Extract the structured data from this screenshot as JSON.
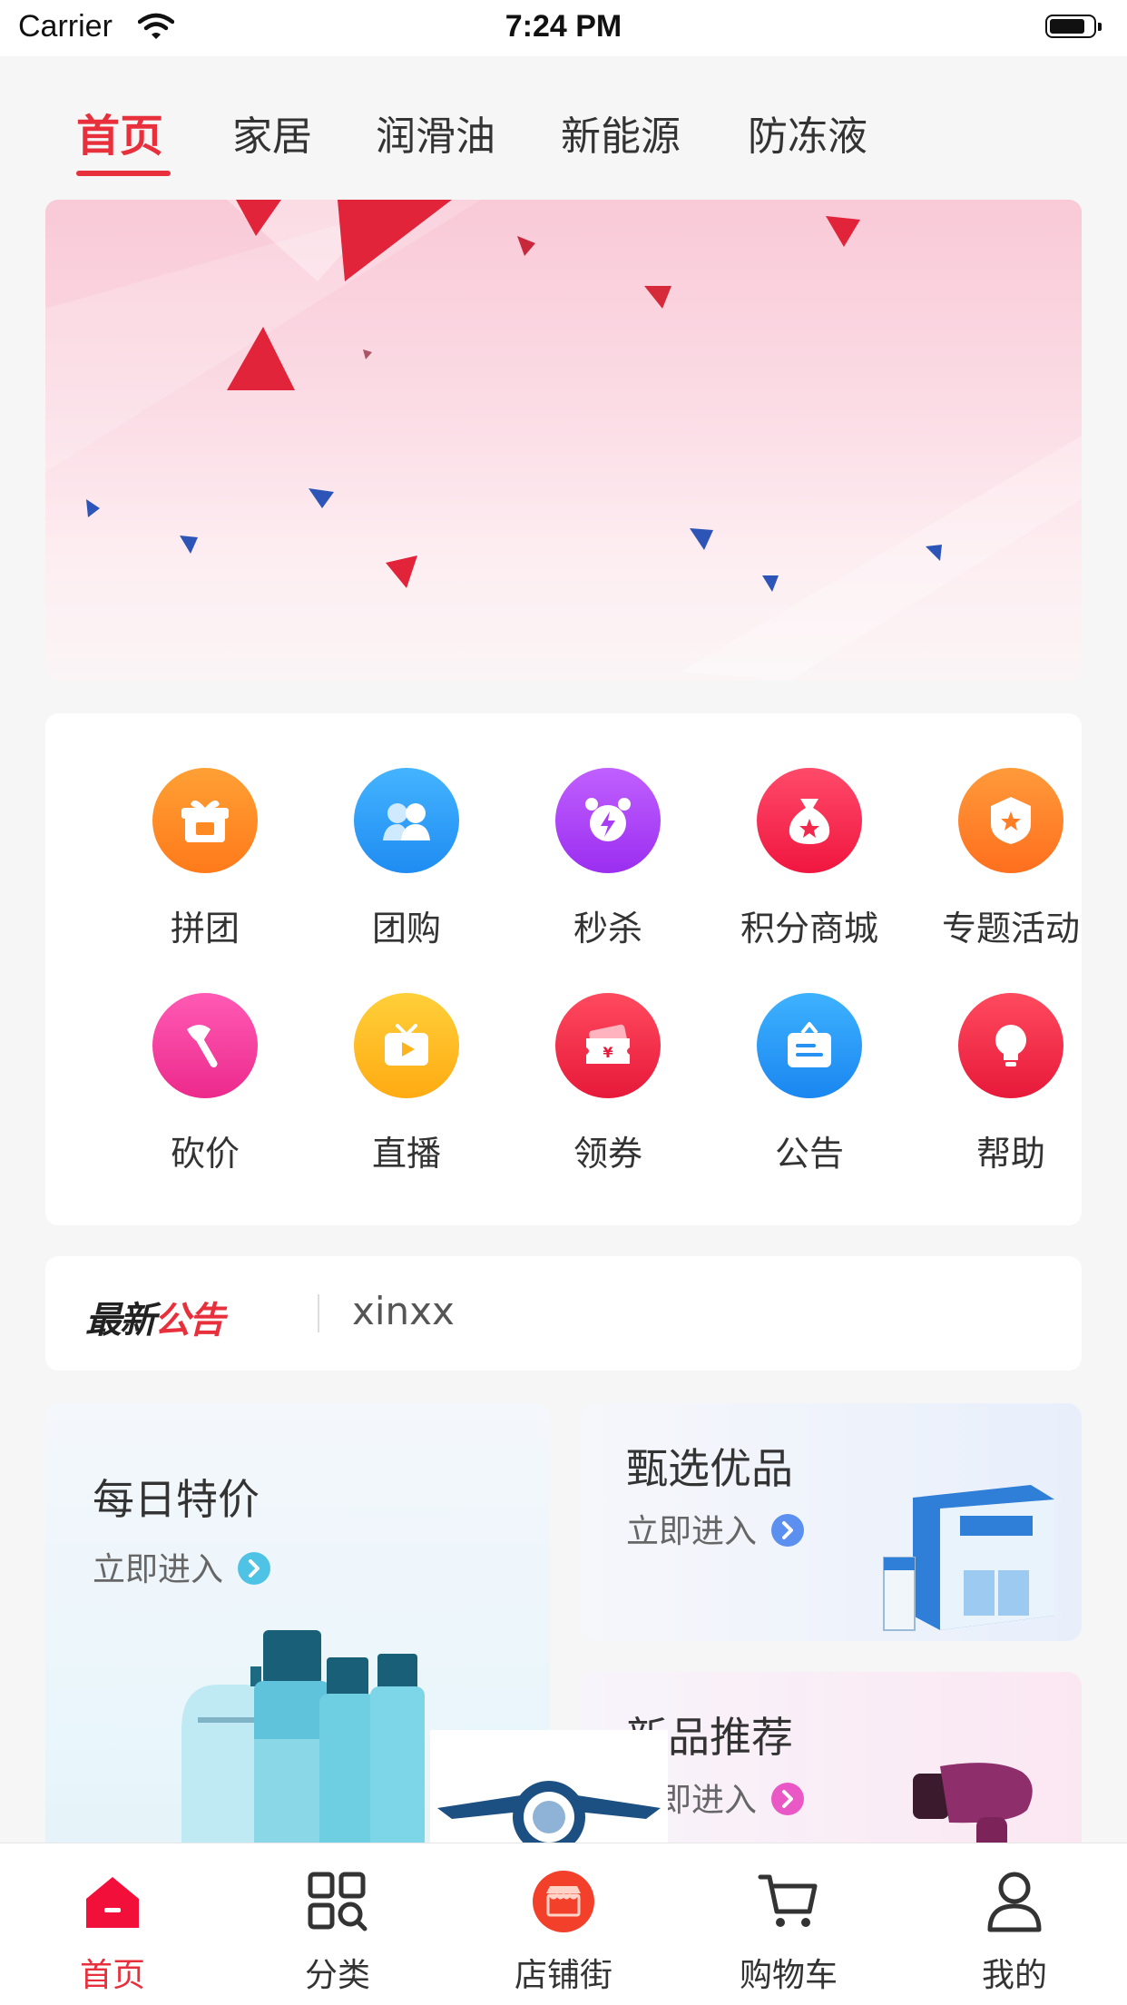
{
  "status_bar": {
    "carrier": "Carrier",
    "time": "7:24 PM"
  },
  "tabs": [
    {
      "label": "首页",
      "active": true
    },
    {
      "label": "家居"
    },
    {
      "label": "润滑油"
    },
    {
      "label": "新能源"
    },
    {
      "label": "防冻液"
    }
  ],
  "grid": {
    "items": [
      {
        "label": "拼团",
        "icon": "gift-icon"
      },
      {
        "label": "团购",
        "icon": "group-icon"
      },
      {
        "label": "秒杀",
        "icon": "alarm-clock-icon"
      },
      {
        "label": "积分商城",
        "icon": "money-bag-icon"
      },
      {
        "label": "专题活动",
        "icon": "badge-star-icon"
      },
      {
        "label": "砍价",
        "icon": "axe-icon"
      },
      {
        "label": "直播",
        "icon": "tv-play-icon"
      },
      {
        "label": "领券",
        "icon": "coupon-icon"
      },
      {
        "label": "公告",
        "icon": "notice-board-icon"
      },
      {
        "label": "帮助",
        "icon": "bulb-icon"
      }
    ]
  },
  "notice": {
    "title_part1": "最新",
    "title_part2": "公告",
    "text": "xinxx"
  },
  "promos": {
    "daily": {
      "title": "每日特价",
      "enter": "立即进入"
    },
    "select": {
      "title": "甄选优品",
      "enter": "立即进入"
    },
    "new": {
      "title": "新品推荐",
      "enter": "立即进入"
    }
  },
  "bottom_nav": [
    {
      "label": "首页",
      "icon": "home-icon",
      "active": true
    },
    {
      "label": "分类",
      "icon": "category-icon"
    },
    {
      "label": "店铺街",
      "icon": "shop-icon"
    },
    {
      "label": "购物车",
      "icon": "cart-icon"
    },
    {
      "label": "我的",
      "icon": "user-icon"
    }
  ],
  "colors": {
    "accent": "#e8303d"
  }
}
